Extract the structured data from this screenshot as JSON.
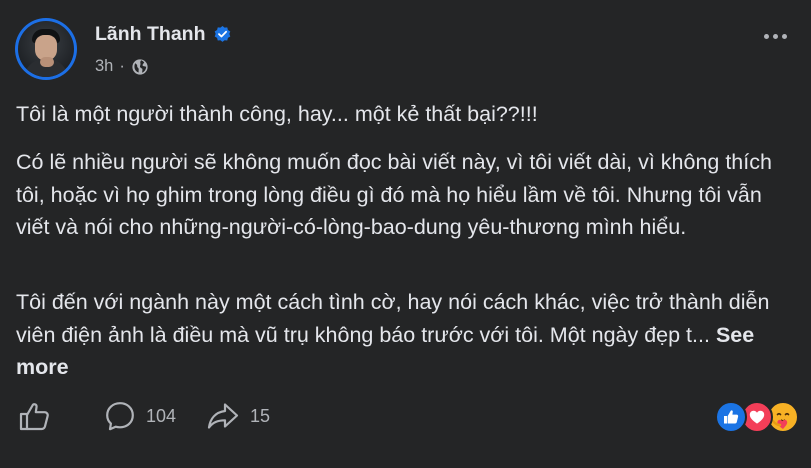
{
  "post": {
    "author": "Lãnh Thanh",
    "timestamp": "3h",
    "privacy_icon": "globe-icon",
    "verified_icon": "verified-badge-icon",
    "paragraphs": [
      "Tôi là một người thành công, hay... một kẻ thất bại??!!!",
      "Có lẽ nhiều người sẽ không muốn đọc bài viết này, vì tôi viết dài, vì không thích tôi, hoặc vì họ ghim trong lòng điều gì đó mà họ hiểu lầm về tôi. Nhưng tôi vẫn viết và nói cho những-người-có-lòng-bao-dung yêu-thương mình hiểu.",
      "Tôi đến với ngành này một cách tình cờ, hay nói cách khác, việc trở thành diễn viên điện ảnh là điều mà vũ trụ không báo trước với tôi. Một ngày đẹp t..."
    ],
    "see_more": "See more"
  },
  "actions": {
    "like_icon": "thumbs-up-icon",
    "comment_icon": "comment-icon",
    "comment_count": "104",
    "share_icon": "share-icon",
    "share_count": "15"
  },
  "reactions": [
    "like-reaction",
    "love-reaction",
    "care-reaction"
  ],
  "colors": {
    "background": "#242526",
    "text_primary": "#e4e6eb",
    "text_secondary": "#b0b3b8",
    "accent_blue": "#1b74e4",
    "love_red": "#f33e58",
    "care_yellow": "#f7b125"
  }
}
